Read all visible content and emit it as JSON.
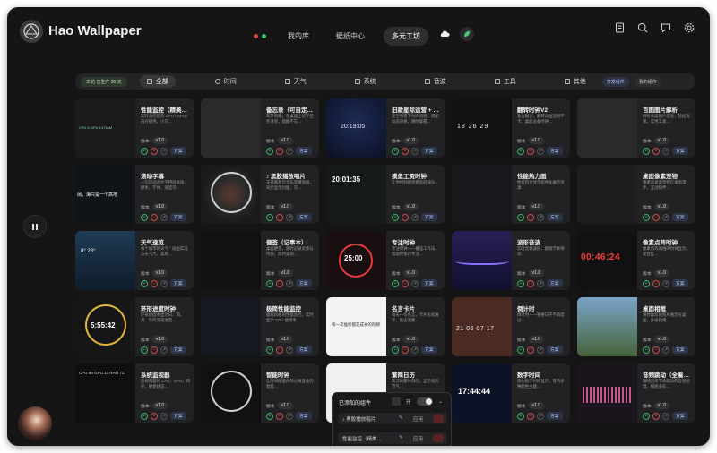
{
  "app": {
    "title": "Hao Wallpaper"
  },
  "nav": {
    "tabs": [
      "我的库",
      "壁纸中心",
      "多元工坊"
    ],
    "active": 2
  },
  "colors": {
    "dot_red": "#e04646",
    "dot_green": "#37c16a",
    "accent_green": "#3bb26a",
    "accent_red": "#d04848",
    "apply_bg": "#2c3448"
  },
  "filter": {
    "badge": "工坊 已生产 20 天",
    "categories": [
      "全部",
      "时间",
      "天气",
      "系统",
      "音波",
      "工具",
      "其他"
    ],
    "mini_tabs": [
      "开发组件",
      "我的组件"
    ]
  },
  "card_common": {
    "version_label": "版本",
    "version_value": "v1.0",
    "apply_label": "方案"
  },
  "cards": [
    {
      "title": "性能监控（精美…",
      "desc": "实时监控您的 CPU / GPU / 内存使用，小巧…",
      "thumb_text": "CPU 6  GPU 13  RAM"
    },
    {
      "title": "备忘录（可自定…",
      "desc": "简单有趣，在桌面上记下任务清单，提醒不忘…",
      "thumb_text": "备忘录"
    },
    {
      "title": "旧款星际运营 + …",
      "desc": "星空背景下时间流逝，搭配动态效果，随时掌握…",
      "thumb_text": "20:19:05"
    },
    {
      "title": "翻转时钟V2",
      "desc": "复古翻页，翻转动画流畅不卡，桌面必备时钟…",
      "thumb_text": "18 26 29"
    },
    {
      "title": "百图图片解析",
      "desc": "解析各类图片信息，轻松查看，实用工具…",
      "thumb_text": ""
    },
    {
      "title": "滚动字幕",
      "desc": "一句话动态文字特效滚动，颜色、字体、速度可…",
      "thumb_text": "阔，海只是一个高地"
    },
    {
      "title": "♪ 黑胶播放唱片",
      "desc": "支持网易云音乐等播放器，同步显示封面，可…",
      "thumb_text": ""
    },
    {
      "title": "摸鱼工资时钟",
      "desc": "让你时刻感受摸鱼的快乐…",
      "thumb_text": "20:01:35"
    },
    {
      "title": "性能热力图",
      "desc": "性能热力显示组件化展示资源…",
      "thumb_text": ""
    },
    {
      "title": "桌面像素宠物",
      "desc": "像素风桌面宠物在桌面漫步，互动陪伴…",
      "thumb_text": ""
    },
    {
      "title": "天气速览",
      "desc": "每个城市的天气 ° 动画实况与天气尺，美观…",
      "thumb_text": "8° 28°"
    },
    {
      "title": "便签（记事本）",
      "desc": "桌面便签，随时记录灵感与待办，简约美观…",
      "thumb_text": ""
    },
    {
      "title": "专注时钟",
      "desc": "专注时钟——番茄工作法，帮助你保持专注…",
      "thumb_text": "25:00"
    },
    {
      "title": "波形音波",
      "desc": "实时音频波形，跟随节奏律动…",
      "thumb_text": ""
    },
    {
      "title": "像素点阵时钟",
      "desc": "像素点阵风格的时钟显示，复古红…",
      "thumb_text": "00:46:24"
    },
    {
      "title": "环形进度时钟",
      "desc": "环形进度条显示日、周、月、年的流逝进度…",
      "thumb_text": "5:55:42"
    },
    {
      "title": "极简性能监控",
      "desc": "极简风格的性能监控，实时显示 CPU 使用率…",
      "thumb_text": ""
    },
    {
      "title": "名言卡片",
      "desc": "每天一句名言，卡片形式展示，励志温暖…",
      "thumb_text": "每一次挫折都是成长的阶梯"
    },
    {
      "title": "倒计时",
      "desc": "倒计时——重要日子不再错过…",
      "thumb_text": "21 06 07 17"
    },
    {
      "title": "桌面相框",
      "desc": "将你喜欢的照片展示在桌面，多张轮播…",
      "thumb_text": ""
    },
    {
      "title": "系统监视器",
      "desc": "监视电脑的 CPU、GPU、内存、硬盘状态…",
      "thumb_text": "CPU 66 GPU 13 RAM 72"
    },
    {
      "title": "智能时钟",
      "desc": "让时间随着你的心情变化的智能…",
      "thumb_text": ""
    },
    {
      "title": "繁简日历",
      "desc": "简洁的繁体日历，显示农历节气…",
      "thumb_text": ""
    },
    {
      "title": "数字时间",
      "desc": "简约数字时间显示，支持多种颜色主题…",
      "thumb_text": "17:44:44"
    },
    {
      "title": "音频跳动（全着…",
      "desc": "跟随音乐节奏跳动的音频频谱，绚丽多彩…",
      "thumb_text": ""
    }
  ],
  "popup": {
    "title": "已添加的组件",
    "toggle_label": "开",
    "rows": [
      {
        "name": "♪ 黑胶播放唱片",
        "action": "应用"
      },
      {
        "name": "性能监控（精美…",
        "action": "应用"
      }
    ]
  }
}
